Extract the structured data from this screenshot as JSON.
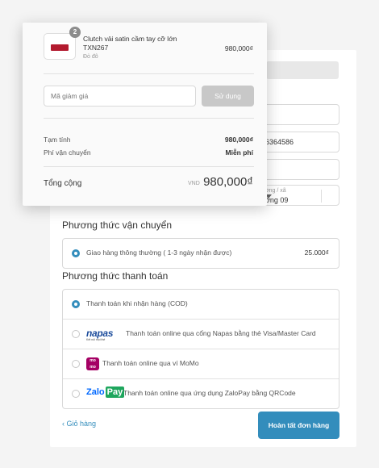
{
  "summary": {
    "product": {
      "quantity": "2",
      "name_line1": "Clutch vải satin cầm tay cỡ lớn",
      "name_line2": "TXN267",
      "variant": "Đỏ đô",
      "price": "980,000₫",
      "thumb_color": "#b31b2f"
    },
    "discount": {
      "placeholder": "Mã giảm giá",
      "apply_label": "Sử dụng"
    },
    "subtotal_label": "Tạm tính",
    "subtotal_value": "980,000₫",
    "shipping_label": "Phí vận chuyển",
    "shipping_value": "Miễn phí",
    "total_label": "Tổng cộng",
    "total_currency": "VND",
    "total_value": "980,000₫"
  },
  "form": {
    "phone_partial": "6364586",
    "ward_label": "Phường / xã",
    "ward_label_partial": "ờng / xã",
    "ward_value_partial": "ờng 09"
  },
  "shipping_method": {
    "title": "Phương thức vận chuyển",
    "option_label": "Giao hàng thông thường ( 1-3 ngày nhận được)",
    "option_price": "25.000₫"
  },
  "payment_method": {
    "title": "Phương thức thanh toán",
    "options": [
      {
        "label": "Thanh toán khi nhận hàng (COD)",
        "selected": true,
        "icon": ""
      },
      {
        "label": "Thanh toán online qua cổng Napas bằng thẻ Visa/Master Card",
        "selected": false,
        "icon": "napas-logo",
        "logo_text": "napas",
        "logo_sub": "Kết nối mọi thẻ"
      },
      {
        "label": "Thanh toán online qua ví MoMo",
        "selected": false,
        "icon": "momo-logo",
        "logo_text_top": "mo",
        "logo_text_bottom": "mo"
      },
      {
        "label": "Thanh toán online qua ứng dụng ZaloPay bằng QRCode",
        "selected": false,
        "icon": "zalopay-logo",
        "logo_text_a": "Zalo",
        "logo_text_b": "Pay"
      }
    ]
  },
  "footer": {
    "back_label": "Giỏ hàng",
    "finish_label": "Hoàn tất đơn hàng"
  },
  "colors": {
    "accent": "#338dbc",
    "momo": "#a50064",
    "zalo_blue": "#0068ff",
    "zalo_green": "#1ea65d",
    "napas": "#1b4b9b"
  }
}
